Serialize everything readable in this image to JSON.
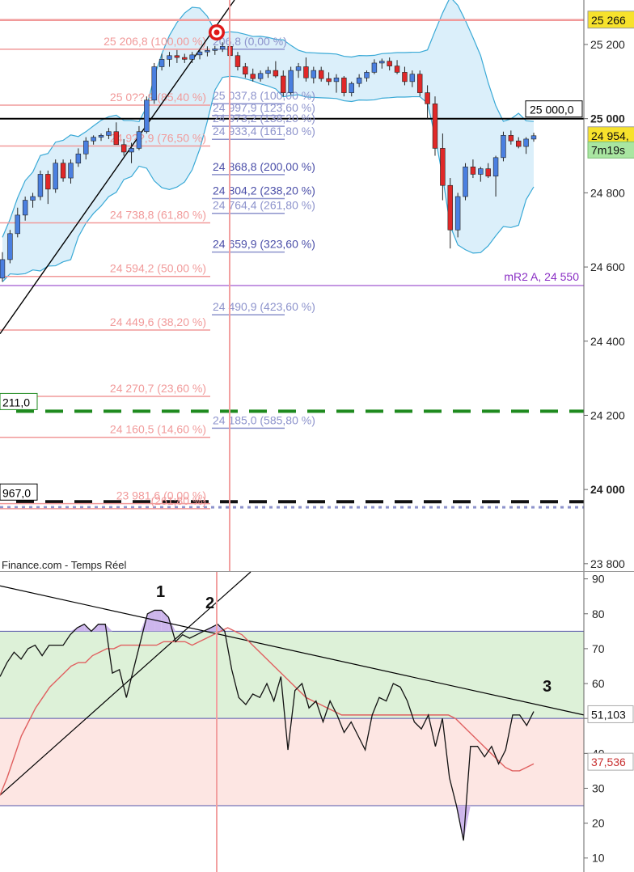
{
  "colors": {
    "candle_up": "#4a7fe0",
    "candle_down": "#e02828",
    "bollinger_fill": "#dbeffa",
    "bollinger_line": "#39a9d6",
    "fib_red": "#f19a9a",
    "fib_blue": "#8d93cc",
    "fib_dark": "#4a4ea8",
    "cursor_line": "#f2a0a0",
    "pivot": "#8a2fc4",
    "green_level": "#1e8a1e",
    "rsi_line": "#111111",
    "rsi_ma": "#e06060",
    "overbought_fill": "#ddf1d8",
    "oversold_fill": "#fde6e3"
  },
  "source_label": "Finance.com - Temps Réel",
  "markers": {
    "target_icon": "bullseye-icon"
  },
  "chart_data": [
    {
      "type": "candlestick",
      "title": "",
      "y_axis": {
        "ticks": [
          "25 200",
          "25 000",
          "24 800",
          "24 600",
          "24 400",
          "24 200",
          "24 000",
          "23 800"
        ],
        "tick_values": [
          25200,
          25000,
          24800,
          24600,
          24400,
          24200,
          24000,
          23800
        ],
        "ylim": [
          23780,
          25320
        ]
      },
      "price_tags": [
        {
          "text": "25 266",
          "value": 25266,
          "style": "yellow"
        },
        {
          "text": "25 000,0",
          "value": 25000,
          "style": "box"
        },
        {
          "text": "24 954,",
          "value": 24954,
          "style": "yellow"
        },
        {
          "text": "7m19s",
          "value": 24920,
          "style": "green"
        },
        {
          "text": "211,0",
          "value": 24211,
          "style": "left-box"
        },
        {
          "text": "967,0",
          "value": 23967,
          "style": "left-box"
        }
      ],
      "pivot_label": "mR2 A, 24 550",
      "levels": [
        {
          "name": "resistance",
          "value": 25266,
          "style": "pink-solid"
        },
        {
          "name": "round-level",
          "value": 25000,
          "style": "black-solid"
        },
        {
          "name": "mR2",
          "value": 24550,
          "style": "purple-solid"
        },
        {
          "name": "support-green",
          "value": 24211,
          "style": "green-dashed"
        },
        {
          "name": "support-black",
          "value": 23967,
          "style": "black-dashed"
        },
        {
          "name": "support-dotted",
          "value": 23952,
          "style": "purple-dotted"
        }
      ],
      "fib_red": [
        {
          "label": "25 206,8 (100,00 %)",
          "value": 25206.8
        },
        {
          "label": "25 0??,9 (85,40 %)",
          "value": 25056
        },
        {
          "label": "24 9??,9 (76,50 %)",
          "value": 24946
        },
        {
          "label": "24 738,8 (61,80 %)",
          "value": 24738.8
        },
        {
          "label": "24 594,2 (50,00 %)",
          "value": 24594.2
        },
        {
          "label": "24 449,6 (38,20 %)",
          "value": 24449.6
        },
        {
          "label": "24 270,7 (23,60 %)",
          "value": 24270.7
        },
        {
          "label": "24 160,5 (14,60 %)",
          "value": 24160.5
        },
        {
          "label": "23 981,6 (0,00 %)",
          "value": 23981.6
        },
        {
          "label": "(261,80 %)",
          "value": 23968
        }
      ],
      "fib_blue": [
        {
          "label": "206,8 (0,00 %)",
          "value": 25206.8,
          "dark": false
        },
        {
          "label": "25 037,8 (100,00 %)",
          "value": 25060,
          "dark": false
        },
        {
          "label": "24 997,9 (123,60 %)",
          "value": 25028,
          "dark": false
        },
        {
          "label": "24 973,2 (138,20 %)",
          "value": 24999,
          "dark": false
        },
        {
          "label": "24 933,4 (161,80 %)",
          "value": 24964,
          "dark": false
        },
        {
          "label": "24 868,8 (200,00 %)",
          "value": 24868.8,
          "dark": true
        },
        {
          "label": "24 804,2 (238,20 %)",
          "value": 24804.2,
          "dark": true
        },
        {
          "label": "24 764,4 (261,80 %)",
          "value": 24764.4,
          "dark": false
        },
        {
          "label": "24 659,9 (323,60 %)",
          "value": 24659.9,
          "dark": true
        },
        {
          "label": "24 490,9 (423,60 %)",
          "value": 24490.9,
          "dark": false
        },
        {
          "label": "24 185,0 (585,80 %)",
          "value": 24185,
          "dark": false
        }
      ],
      "candles": [
        {
          "o": 24570,
          "h": 24640,
          "l": 24560,
          "c": 24620
        },
        {
          "o": 24620,
          "h": 24700,
          "l": 24610,
          "c": 24690
        },
        {
          "o": 24690,
          "h": 24760,
          "l": 24680,
          "c": 24740
        },
        {
          "o": 24740,
          "h": 24790,
          "l": 24725,
          "c": 24780
        },
        {
          "o": 24780,
          "h": 24800,
          "l": 24760,
          "c": 24790
        },
        {
          "o": 24790,
          "h": 24860,
          "l": 24780,
          "c": 24850
        },
        {
          "o": 24850,
          "h": 24860,
          "l": 24770,
          "c": 24810
        },
        {
          "o": 24810,
          "h": 24890,
          "l": 24800,
          "c": 24880
        },
        {
          "o": 24880,
          "h": 24890,
          "l": 24830,
          "c": 24840
        },
        {
          "o": 24840,
          "h": 24890,
          "l": 24825,
          "c": 24880
        },
        {
          "o": 24880,
          "h": 24920,
          "l": 24870,
          "c": 24905
        },
        {
          "o": 24905,
          "h": 24950,
          "l": 24890,
          "c": 24940
        },
        {
          "o": 24940,
          "h": 24955,
          "l": 24930,
          "c": 24950
        },
        {
          "o": 24950,
          "h": 24960,
          "l": 24940,
          "c": 24955
        },
        {
          "o": 24955,
          "h": 24975,
          "l": 24945,
          "c": 24965
        },
        {
          "o": 24965,
          "h": 24990,
          "l": 24950,
          "c": 24930
        },
        {
          "o": 24930,
          "h": 24945,
          "l": 24900,
          "c": 24910
        },
        {
          "o": 24910,
          "h": 24935,
          "l": 24880,
          "c": 24920
        },
        {
          "o": 24920,
          "h": 24980,
          "l": 24915,
          "c": 24965
        },
        {
          "o": 24965,
          "h": 25060,
          "l": 24960,
          "c": 25050
        },
        {
          "o": 25050,
          "h": 25150,
          "l": 25040,
          "c": 25140
        },
        {
          "o": 25140,
          "h": 25175,
          "l": 25130,
          "c": 25160
        },
        {
          "o": 25160,
          "h": 25180,
          "l": 25140,
          "c": 25170
        },
        {
          "o": 25170,
          "h": 25185,
          "l": 25150,
          "c": 25165
        },
        {
          "o": 25165,
          "h": 25175,
          "l": 25150,
          "c": 25160
        },
        {
          "o": 25160,
          "h": 25180,
          "l": 25150,
          "c": 25172
        },
        {
          "o": 25172,
          "h": 25188,
          "l": 25160,
          "c": 25180
        },
        {
          "o": 25180,
          "h": 25195,
          "l": 25168,
          "c": 25184
        },
        {
          "o": 25184,
          "h": 25196,
          "l": 25172,
          "c": 25188
        },
        {
          "o": 25188,
          "h": 25206,
          "l": 25180,
          "c": 25195
        },
        {
          "o": 25195,
          "h": 25206,
          "l": 25160,
          "c": 25170
        },
        {
          "o": 25170,
          "h": 25180,
          "l": 25130,
          "c": 25140
        },
        {
          "o": 25140,
          "h": 25150,
          "l": 25110,
          "c": 25120
        },
        {
          "o": 25120,
          "h": 25135,
          "l": 25100,
          "c": 25108
        },
        {
          "o": 25108,
          "h": 25130,
          "l": 25100,
          "c": 25122
        },
        {
          "o": 25122,
          "h": 25140,
          "l": 25110,
          "c": 25130
        },
        {
          "o": 25130,
          "h": 25155,
          "l": 25110,
          "c": 25115
        },
        {
          "o": 25115,
          "h": 25130,
          "l": 25060,
          "c": 25070
        },
        {
          "o": 25070,
          "h": 25140,
          "l": 25065,
          "c": 25130
        },
        {
          "o": 25130,
          "h": 25150,
          "l": 25110,
          "c": 25140
        },
        {
          "o": 25140,
          "h": 25165,
          "l": 25100,
          "c": 25110
        },
        {
          "o": 25110,
          "h": 25140,
          "l": 25095,
          "c": 25130
        },
        {
          "o": 25130,
          "h": 25140,
          "l": 25100,
          "c": 25108
        },
        {
          "o": 25108,
          "h": 25125,
          "l": 25090,
          "c": 25100
        },
        {
          "o": 25100,
          "h": 25120,
          "l": 25070,
          "c": 25110
        },
        {
          "o": 25110,
          "h": 25115,
          "l": 25060,
          "c": 25070
        },
        {
          "o": 25070,
          "h": 25100,
          "l": 25060,
          "c": 25095
        },
        {
          "o": 25095,
          "h": 25120,
          "l": 25085,
          "c": 25110
        },
        {
          "o": 25110,
          "h": 25130,
          "l": 25100,
          "c": 25125
        },
        {
          "o": 25125,
          "h": 25160,
          "l": 25120,
          "c": 25150
        },
        {
          "o": 25150,
          "h": 25162,
          "l": 25135,
          "c": 25155
        },
        {
          "o": 25155,
          "h": 25165,
          "l": 25130,
          "c": 25142
        },
        {
          "o": 25142,
          "h": 25158,
          "l": 25120,
          "c": 25125
        },
        {
          "o": 25125,
          "h": 25140,
          "l": 25090,
          "c": 25100
        },
        {
          "o": 25100,
          "h": 25130,
          "l": 25085,
          "c": 25120
        },
        {
          "o": 25120,
          "h": 25130,
          "l": 25060,
          "c": 25070
        },
        {
          "o": 25070,
          "h": 25090,
          "l": 25000,
          "c": 25040
        },
        {
          "o": 25040,
          "h": 25060,
          "l": 24900,
          "c": 24920
        },
        {
          "o": 24920,
          "h": 24960,
          "l": 24780,
          "c": 24820
        },
        {
          "o": 24820,
          "h": 24840,
          "l": 24650,
          "c": 24700
        },
        {
          "o": 24700,
          "h": 24800,
          "l": 24680,
          "c": 24790
        },
        {
          "o": 24790,
          "h": 24880,
          "l": 24780,
          "c": 24870
        },
        {
          "o": 24870,
          "h": 24890,
          "l": 24840,
          "c": 24850
        },
        {
          "o": 24850,
          "h": 24870,
          "l": 24830,
          "c": 24865
        },
        {
          "o": 24865,
          "h": 24880,
          "l": 24840,
          "c": 24845
        },
        {
          "o": 24845,
          "h": 24900,
          "l": 24790,
          "c": 24895
        },
        {
          "o": 24895,
          "h": 24965,
          "l": 24885,
          "c": 24955
        },
        {
          "o": 24955,
          "h": 24968,
          "l": 24930,
          "c": 24940
        },
        {
          "o": 24940,
          "h": 24950,
          "l": 24920,
          "c": 24925
        },
        {
          "o": 24925,
          "h": 24950,
          "l": 24905,
          "c": 24945
        },
        {
          "o": 24945,
          "h": 24962,
          "l": 24938,
          "c": 24954
        }
      ]
    },
    {
      "type": "line",
      "title": "",
      "y_axis": {
        "ticks": [
          "90",
          "80",
          "70",
          "60",
          "50",
          "40",
          "30",
          "20",
          "10"
        ],
        "tick_values": [
          90,
          80,
          70,
          60,
          50,
          40,
          30,
          20,
          10
        ],
        "ylim": [
          6,
          92
        ]
      },
      "zones": {
        "upper": 75,
        "middle": 50,
        "lower": 25
      },
      "value_tags": [
        {
          "text": "51,103",
          "value": 51.1
        },
        {
          "text": "37,536",
          "value": 37.5
        }
      ],
      "wave_labels": [
        "1",
        "2",
        "3"
      ],
      "series": [
        {
          "values": [
            62,
            66,
            69,
            67,
            70,
            71,
            68,
            71,
            71,
            71,
            74,
            76,
            77,
            75,
            77,
            77,
            63,
            64,
            56,
            64,
            72,
            80,
            81,
            81,
            79,
            72,
            74,
            73,
            74,
            75,
            76,
            77,
            75,
            64,
            56,
            54,
            57,
            56,
            60,
            55,
            62,
            41,
            58,
            60,
            53,
            55,
            49,
            55,
            51,
            46,
            49,
            45,
            41,
            51,
            56,
            55,
            60,
            59,
            55,
            49,
            47,
            51,
            42,
            50,
            33,
            25,
            15,
            42,
            42,
            39,
            42,
            37,
            41,
            51,
            51,
            48,
            52
          ]
        },
        {
          "values": [
            28,
            33,
            39,
            45,
            49,
            53,
            56,
            59,
            61,
            63,
            65,
            66,
            66,
            68,
            69,
            70,
            70,
            71,
            71,
            71,
            71,
            71,
            71,
            72,
            72,
            72,
            72,
            71,
            72,
            73,
            74,
            75,
            76,
            75,
            74,
            72,
            70,
            68,
            66,
            64,
            62,
            60,
            58,
            56,
            55,
            54,
            53,
            52,
            51,
            51,
            51,
            51,
            51,
            51,
            51,
            51,
            51,
            51,
            51,
            51,
            51,
            51,
            51,
            51,
            50,
            48,
            46,
            44,
            42,
            40,
            38,
            36,
            35,
            35,
            36,
            37
          ]
        }
      ]
    }
  ]
}
